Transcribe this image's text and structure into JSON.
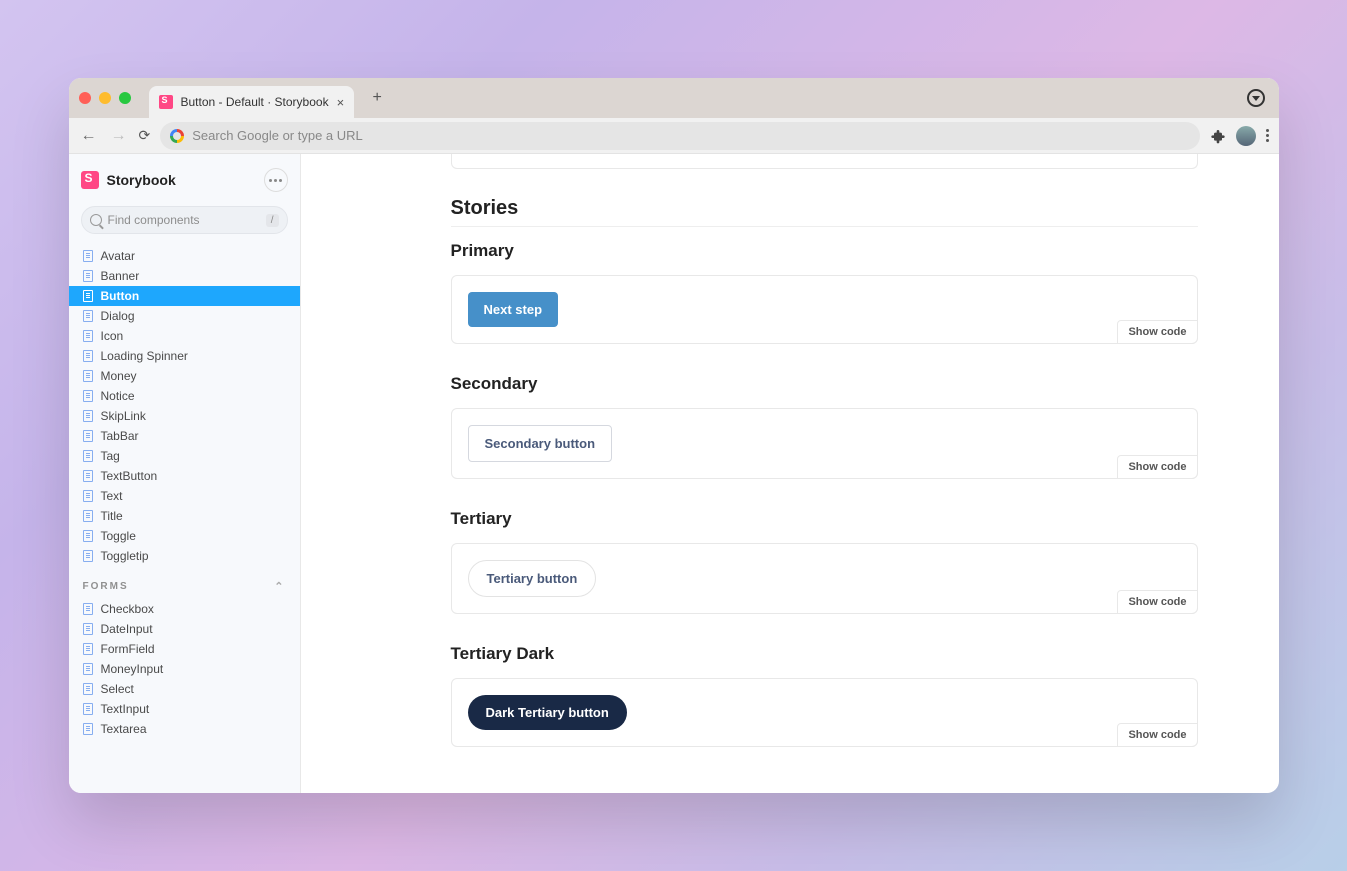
{
  "browser": {
    "tab_title": "Button - Default · Storybook",
    "omnibox_placeholder": "Search Google or type a URL"
  },
  "sidebar": {
    "brand": "Storybook",
    "search_placeholder": "Find components",
    "search_kbd": "/",
    "items": [
      {
        "label": "Avatar"
      },
      {
        "label": "Banner"
      },
      {
        "label": "Button",
        "active": true
      },
      {
        "label": "Dialog"
      },
      {
        "label": "Icon"
      },
      {
        "label": "Loading Spinner"
      },
      {
        "label": "Money"
      },
      {
        "label": "Notice"
      },
      {
        "label": "SkipLink"
      },
      {
        "label": "TabBar"
      },
      {
        "label": "Tag"
      },
      {
        "label": "TextButton"
      },
      {
        "label": "Text"
      },
      {
        "label": "Title"
      },
      {
        "label": "Toggle"
      },
      {
        "label": "Toggletip"
      }
    ],
    "group": "FORMS",
    "forms": [
      {
        "label": "Checkbox"
      },
      {
        "label": "DateInput"
      },
      {
        "label": "FormField"
      },
      {
        "label": "MoneyInput"
      },
      {
        "label": "Select"
      },
      {
        "label": "TextInput"
      },
      {
        "label": "Textarea"
      }
    ]
  },
  "content": {
    "section_title": "Stories",
    "show_code": "Show code",
    "stories": [
      {
        "title": "Primary",
        "button_label": "Next step",
        "variant": "primary"
      },
      {
        "title": "Secondary",
        "button_label": "Secondary button",
        "variant": "secondary"
      },
      {
        "title": "Tertiary",
        "button_label": "Tertiary button",
        "variant": "tertiary"
      },
      {
        "title": "Tertiary Dark",
        "button_label": "Dark Tertiary button",
        "variant": "dark"
      }
    ]
  }
}
